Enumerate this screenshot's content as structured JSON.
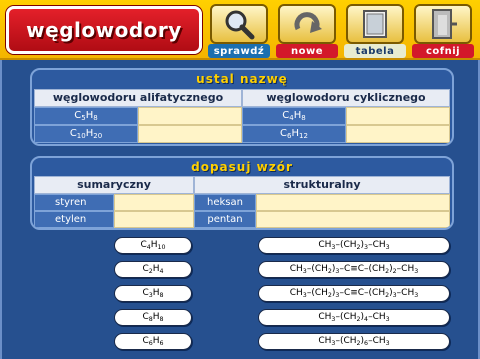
{
  "app": {
    "title": "węglowodory"
  },
  "nav": [
    {
      "id": "sprawdz",
      "label": "sprawdź",
      "icon": "magnifier-icon",
      "bg": "#1b6fb0",
      "color": "#ffffff"
    },
    {
      "id": "nowe",
      "label": "nowe",
      "icon": "refresh-arrow-icon",
      "bg": "#d3182a",
      "color": "#ffffff"
    },
    {
      "id": "tabela",
      "label": "tabela",
      "icon": "window-icon",
      "bg": "#e8ecd0",
      "color": "#1a3a6a"
    },
    {
      "id": "cofnij",
      "label": "cofnij",
      "icon": "door-exit-icon",
      "bg": "#d3182a",
      "color": "#ffffff"
    }
  ],
  "panel1": {
    "title": "ustal nazwę",
    "col1_header": "węglowodoru alifatycznego",
    "col2_header": "węglowodoru cyklicznego",
    "rows": [
      {
        "left": "C5H8",
        "right": "C4H8"
      },
      {
        "left": "C10H20",
        "right": "C6H12"
      }
    ]
  },
  "panel2": {
    "title": "dopasuj wzór",
    "col1_header": "sumaryczny",
    "col2_header": "strukturalny",
    "rows": [
      {
        "left": "styren",
        "right": "heksan"
      },
      {
        "left": "etylen",
        "right": "pentan"
      }
    ]
  },
  "formulas_left": [
    "C4H10",
    "C2H4",
    "C3H8",
    "C8H8",
    "C6H6"
  ],
  "formulas_right": [
    "CH3–(CH2)3–CH3",
    "CH3–(CH2)3–C≡C–(CH2)2–CH3",
    "CH3–(CH2)3–C≡C–(CH2)3–CH3",
    "CH3–(CH2)4–CH3",
    "CH3–(CH2)6–CH3"
  ]
}
